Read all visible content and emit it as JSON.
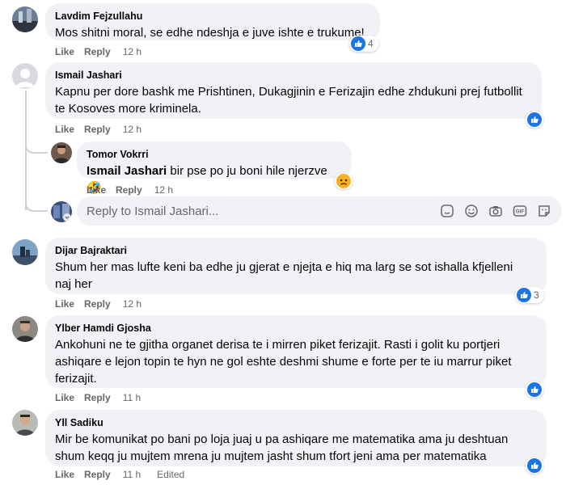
{
  "actions": {
    "like": "Like",
    "reply": "Reply",
    "edited": "Edited"
  },
  "comments": [
    {
      "author": "Lavdim Fejzullahu",
      "text": "Mos shitni moral, se edhe ndeshja e juve ishte e trukume!",
      "time": "12 h",
      "reactions": "4"
    },
    {
      "author": "Ismail Jashari",
      "text_line1": "Kapnu per dore bashk me Prishtinen, Dukagjinin e Ferizajin edhe zhdukuni prej futbollit",
      "text_line2": "te Kosoves more kriminela.",
      "time": "12 h"
    },
    {
      "author": "Tomor Vokrri",
      "mention": "Ismail Jashari",
      "text": " bir pse po ju boni hile njerzve 🤣",
      "time": "12 h"
    },
    {
      "author": "Dijar Bajraktari",
      "text_line1": "Shum her mas lufte keni ba edhe ju gjerat e njejta e hiq ma larg se sot ishalla kfjelleni",
      "text_line2": "naj her",
      "time": "12 h",
      "reactions": "3"
    },
    {
      "author": "Ylber Hamdi Gjosha",
      "text_line1": "Ankohuni ne te gjitha organet derisa te i mirren piket ferizajit. Rasti i golit ku portjeri",
      "text_line2": "ashiqare e lejon topin te hyn ne gol eshte deshmi shume e forte per te iu marrur piket",
      "text_line3": "ferizajit.",
      "time": "11 h"
    },
    {
      "author": "Yll Sadiku",
      "text_line1": "Mir be komunikat po bani po loja juaj u pa ashiqare me matematika ama ju deshtuan",
      "text_line2": "shum keqq ju mujtem mrena ju mujtem jasht shum tfort jeni ama per matematika",
      "time": "11 h",
      "edited": true
    }
  ],
  "reply_box": {
    "placeholder": "Reply to Ismail Jashari..."
  },
  "icons": [
    "like-icon",
    "sad-icon",
    "sticker-icon",
    "emoji-icon",
    "camera-icon",
    "gif-icon",
    "avatar-sticker-icon"
  ],
  "colors": {
    "accent": "#1b74e4",
    "bubble": "#f0f2f5",
    "meta": "#65676b"
  }
}
